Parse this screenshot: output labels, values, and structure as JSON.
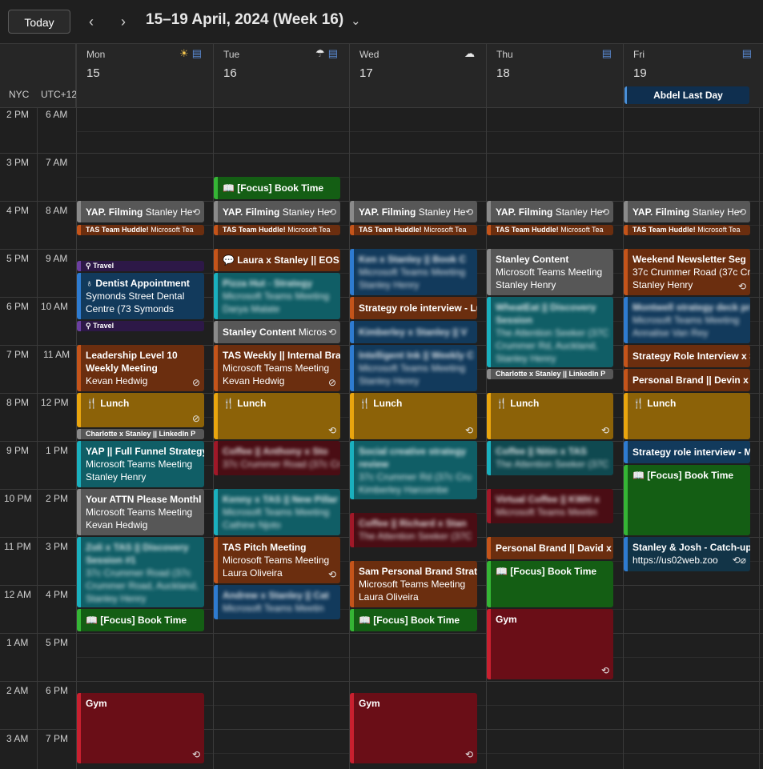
{
  "toolbar": {
    "today": "Today",
    "prev": "‹",
    "next": "›",
    "title": "15–19 April, 2024 (Week 16)",
    "chevron": "⌄"
  },
  "timezones": {
    "primary": "NYC",
    "secondary": "UTC+12"
  },
  "days": [
    {
      "dow": "Mon",
      "num": "15",
      "icons": [
        "sun-icon",
        "document-icon"
      ]
    },
    {
      "dow": "Tue",
      "num": "16",
      "icons": [
        "cloud-rain-icon",
        "document-icon"
      ]
    },
    {
      "dow": "Wed",
      "num": "17",
      "icons": [
        "cloud-icon"
      ]
    },
    {
      "dow": "Thu",
      "num": "18",
      "icons": [
        "document-icon"
      ]
    },
    {
      "dow": "Fri",
      "num": "19",
      "icons": [
        "document-icon"
      ]
    }
  ],
  "allday": {
    "friday": "Abdel Last Day"
  },
  "hours": [
    {
      "nyc": "2 PM",
      "utc": "6 AM"
    },
    {
      "nyc": "3 PM",
      "utc": "7 AM"
    },
    {
      "nyc": "4 PM",
      "utc": "8 AM"
    },
    {
      "nyc": "5 PM",
      "utc": "9 AM"
    },
    {
      "nyc": "6 PM",
      "utc": "10 AM"
    },
    {
      "nyc": "7 PM",
      "utc": "11 AM"
    },
    {
      "nyc": "8 PM",
      "utc": "12 PM"
    },
    {
      "nyc": "9 PM",
      "utc": "1 PM"
    },
    {
      "nyc": "10 PM",
      "utc": "2 PM"
    },
    {
      "nyc": "11 PM",
      "utc": "3 PM"
    },
    {
      "nyc": "12 AM",
      "utc": "4 PM"
    },
    {
      "nyc": "1 AM",
      "utc": "5 PM"
    },
    {
      "nyc": "2 AM",
      "utc": "6 PM"
    },
    {
      "nyc": "3 AM",
      "utc": "7 PM"
    }
  ],
  "events": {
    "mon": {
      "yap": {
        "title": "YAP. Filming",
        "note": "Stanley He"
      },
      "tas": {
        "title": "TAS Team Huddle!",
        "note": "Microsoft Tea"
      },
      "travel1": "Travel",
      "dentist": {
        "title": "Dentist Appointment",
        "l1": "Symonds Street Dental",
        "l2": "Centre (73 Symonds"
      },
      "travel2": "Travel",
      "leadership": {
        "title": "Leadership Level 10",
        "l1": "Weekly Meeting",
        "l2": "Kevan Hedwig"
      },
      "lunch": "Lunch",
      "charlotte": "Charlotte x Stanley || LinkedIn P",
      "yapfunnel": {
        "title": "YAP || Full Funnel Strategy",
        "l1": "Microsoft Teams Meeting",
        "l2": "Stanley Henry"
      },
      "attn": {
        "title": "Your ATTN Please Monthl",
        "l1": "Microsoft Teams Meeting",
        "l2": "Kevan Hedwig"
      },
      "zoli": {
        "title": "Zoli x TAS || Discovery",
        "l1": "Session #1",
        "l2": "37c Crummer Road (37c",
        "l3": "Crummer Road, Auckland,",
        "l4": "Stanley Henry"
      },
      "focus": "[Focus] Book Time",
      "gym": "Gym"
    },
    "tue": {
      "focus": "[Focus] Book Time",
      "yap": {
        "title": "YAP. Filming",
        "note": "Stanley He"
      },
      "tas": {
        "title": "TAS Team Huddle!",
        "note": "Microsoft Tea"
      },
      "laura": "Laura x Stanley || EOS R",
      "pizza": {
        "title": "Pizza Hut - Strategy",
        "l1": "Microsoft Teams Meeting",
        "l2": "Darya Malate"
      },
      "content": {
        "title": "Stanley Content",
        "note": "Micros"
      },
      "tasweekly": {
        "title": "TAS Weekly || Internal Bra",
        "l1": "Microsoft Teams Meeting",
        "l2": "Kevan Hedwig"
      },
      "lunch": "Lunch",
      "coffee": {
        "title": "Coffee || Anthony x Sto",
        "l1": "37c Crummer Road (37c Cr"
      },
      "kenny": {
        "title": "Kenny x TAS || New Pillar",
        "l1": "Microsoft Teams Meeting",
        "l2": "Cathine Njoto"
      },
      "pitch": {
        "title": "TAS Pitch Meeting",
        "l1": "Microsoft Teams Meeting",
        "l2": "Laura Oliveira"
      },
      "andrew": {
        "title": "Andrew x Stanley || Cat",
        "l1": "Microsoft Teams Meetin"
      }
    },
    "wed": {
      "yap": {
        "title": "YAP. Filming",
        "note": "Stanley He"
      },
      "tas": {
        "title": "TAS Team Huddle!",
        "note": "Microsoft Tea"
      },
      "ken": {
        "title": "Ken x Stanley || Book C",
        "l1": "Microsoft Teams Meeting",
        "l2": "Stanley Henry"
      },
      "strategy": "Strategy role interview - Lu",
      "kimberley": "Kimberley x Stanley || V",
      "intelligent": {
        "title": "Intelligent Ink || Weekly C",
        "l1": "Microsoft Teams Meeting",
        "l2": "Stanley Henry"
      },
      "lunch": "Lunch",
      "social": {
        "title": "Social creative strategy",
        "l1": "review",
        "l2": "37c Crummer Rd (37c Cru",
        "l3": "Kimberley Harcombe"
      },
      "coffee": {
        "title": "Coffee || Richard x Stan",
        "l1": "The Attention Seeker (37C"
      },
      "sam": {
        "title": "Sam Personal Brand Strat",
        "l1": "Microsoft Teams Meeting",
        "l2": "Laura Oliveira"
      },
      "focus": "[Focus] Book Time",
      "gym": "Gym"
    },
    "thu": {
      "yap": {
        "title": "YAP. Filming",
        "note": "Stanley He"
      },
      "tas": {
        "title": "TAS Team Huddle!",
        "note": "Microsoft Tea"
      },
      "content": {
        "title": "Stanley Content",
        "l1": "Microsoft Teams Meeting",
        "l2": "Stanley Henry"
      },
      "wheateat": {
        "title": "WheatEat || Discovery",
        "l1": "Session",
        "l2": "The Attention Seeker (37C",
        "l3": "Crummer Rd, Auckland,",
        "l4": "Stanley Henry"
      },
      "charlotte": "Charlotte x Stanley || LinkedIn P",
      "lunch": "Lunch",
      "coffee": {
        "title": "Coffee || Nitin x TAS",
        "l1": "The Attention Seeker (37C"
      },
      "virtual": {
        "title": "Virtual Coffee || KWH x",
        "l1": "Microsoft Teams Meetin"
      },
      "personal": "Personal Brand || David x S",
      "focus": "[Focus] Book Time",
      "gym": "Gym"
    },
    "fri": {
      "yap": {
        "title": "YAP. Filming",
        "note": "Stanley He"
      },
      "tas": {
        "title": "TAS Team Huddle!",
        "note": "Microsoft Tea"
      },
      "newsletter": {
        "title": "Weekend Newsletter Seg",
        "l1": "37c Crummer Road (37c Cr",
        "l2": "Stanley Henry"
      },
      "montwell": {
        "title": "Montwell strategy deck pr",
        "l1": "Microsoft Teams Meeting",
        "l2": "Annalise Van Rey"
      },
      "strategy": "Strategy Role Interview x S",
      "personal": "Personal Brand || Devin x S",
      "lunch": "Lunch",
      "strategy2": "Strategy role interview - M",
      "focus": "[Focus] Book Time",
      "catchup": {
        "title": "Stanley & Josh - Catch-up",
        "l1": "https://us02web.zoo"
      }
    }
  }
}
